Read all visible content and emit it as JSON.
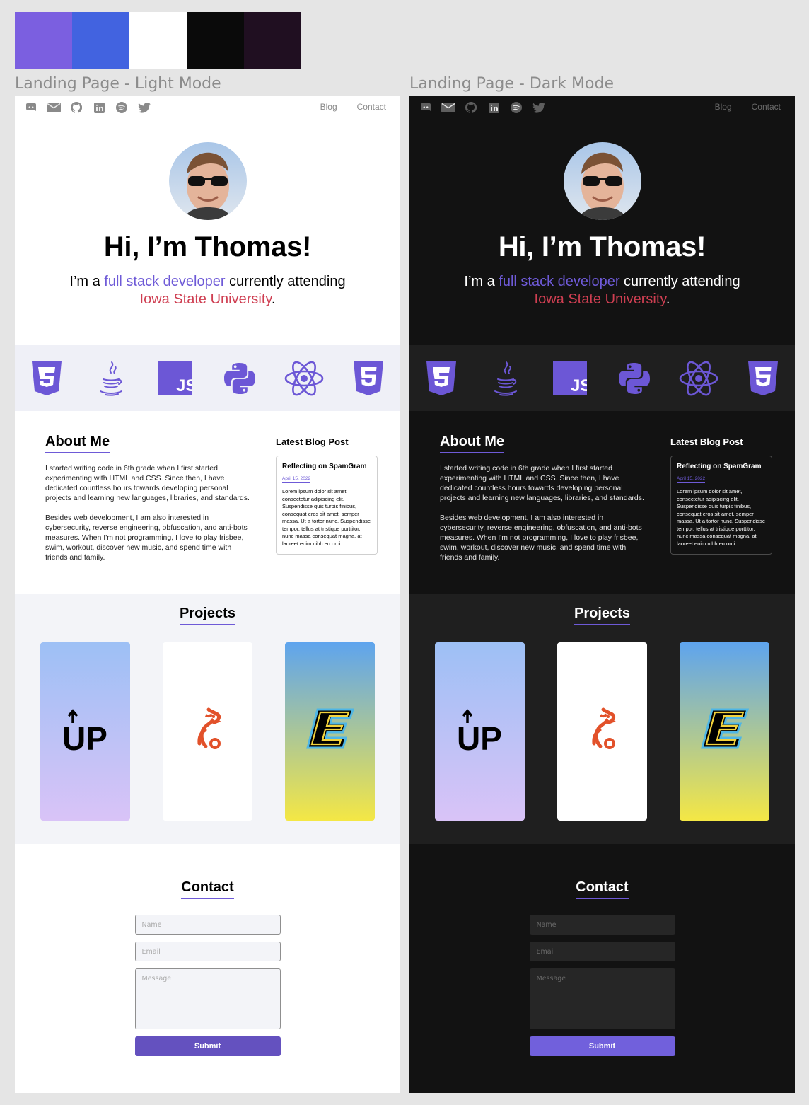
{
  "palette": [
    "#7b5fe0",
    "#4263e0",
    "#ffffff",
    "#0a0a0a",
    "#200f21"
  ],
  "frames": [
    {
      "label": "Landing Page - Light Mode",
      "mode": "light"
    },
    {
      "label": "Landing Page - Dark Mode",
      "mode": "dark"
    }
  ],
  "nav": {
    "icons": [
      "discord-icon",
      "mail-icon",
      "github-icon",
      "linkedin-icon",
      "spotify-icon",
      "twitter-icon"
    ],
    "links": [
      "Blog",
      "Contact"
    ]
  },
  "hero": {
    "greeting": "Hi, I’m Thomas!",
    "tagline_pre": "I’m a ",
    "tagline_role": "full stack developer",
    "tagline_mid": " currently attending ",
    "tagline_school": "Iowa State University",
    "tagline_end": "."
  },
  "tech_icons": [
    "css3-icon",
    "java-icon",
    "javascript-icon",
    "python-icon",
    "react-icon",
    "html5-icon"
  ],
  "about": {
    "title": "About Me",
    "p1": "I started writing code in 6th grade when I first started experimenting with HTML and CSS. Since then, I have dedicated countless hours towards developing personal projects and learning new languages, libraries, and standards.",
    "p2": "Besides web development, I am also interested in cybersecurity, reverse engineering, obfuscation, and anti-bots measures. When I'm not programming, I love to play frisbee, swim, workout, discover new music, and spend time with friends and family."
  },
  "blog": {
    "heading": "Latest Blog Post",
    "post_title": "Reflecting on SpamGram",
    "post_date": "April 15, 2022",
    "excerpt": "Lorem ipsum dolor sit amet, consectetur adipiscing elit. Suspendisse quis turpis finibus, consequat eros sit amet, semper massa. Ut a tortor nunc. Suspendisse tempor, tellus at tristique porttitor, nunc massa consequat magna, at laoreet enim nibh eu orci..."
  },
  "projects": {
    "title": "Projects",
    "items": [
      "up-logo",
      "chicken-logo",
      "e-logo"
    ]
  },
  "contact": {
    "title": "Contact",
    "name_placeholder": "Name",
    "email_placeholder": "Email",
    "message_placeholder": "Message",
    "submit_label": "Submit"
  },
  "colors": {
    "accent": "#6e5ad7",
    "school": "#cf3f52"
  }
}
